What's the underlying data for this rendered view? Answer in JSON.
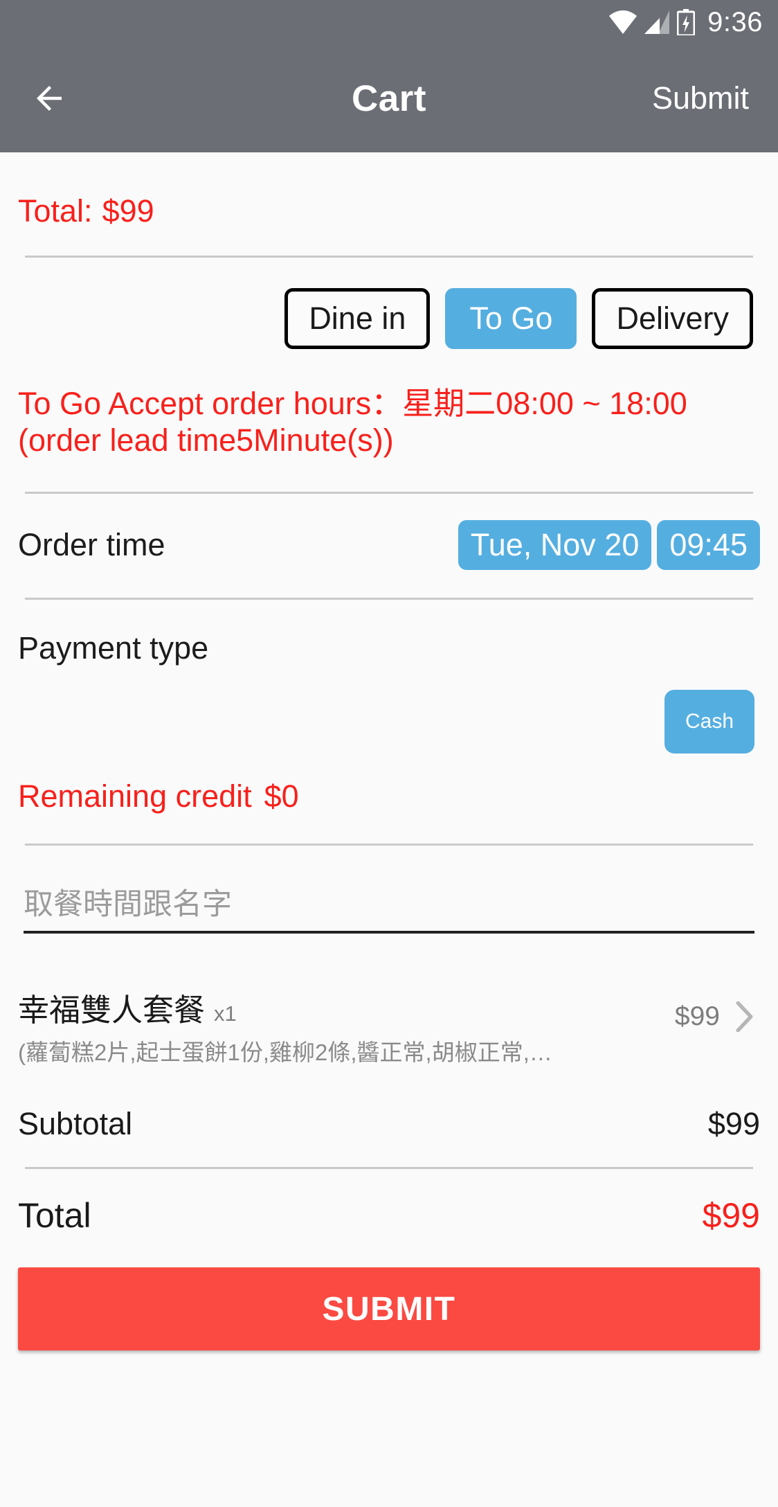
{
  "status_bar": {
    "clock": "9:36",
    "icons": [
      "wifi-icon",
      "cellular-signal-icon",
      "battery-charging-icon"
    ]
  },
  "app_bar": {
    "back_icon": "back-arrow-icon",
    "title": "Cart",
    "action_label": "Submit"
  },
  "summary_top": {
    "label": "Total:",
    "amount": "$99"
  },
  "order_type": {
    "options": [
      {
        "label": "Dine in",
        "selected": false
      },
      {
        "label": "To Go",
        "selected": true
      },
      {
        "label": "Delivery",
        "selected": false
      }
    ]
  },
  "notice": {
    "line1": "To Go Accept order hours：星期二08:00 ~ 18:00",
    "line2": "(order lead time5Minute(s))"
  },
  "order_time": {
    "label": "Order time",
    "date": "Tue, Nov 20",
    "time": "09:45"
  },
  "payment": {
    "label": "Payment type",
    "selected_method": "Cash"
  },
  "credit": {
    "label": "Remaining credit",
    "amount": "$0"
  },
  "note": {
    "value": "",
    "placeholder": "取餐時間跟名字"
  },
  "items": [
    {
      "name": "幸福雙人套餐",
      "qty": "x1",
      "description": "(蘿蔔糕2片,起士蛋餅1份,雞柳2條,醬正常,胡椒正常,…",
      "price": "$99",
      "chevron_icon": "chevron-right-icon"
    }
  ],
  "totals": {
    "subtotal_label": "Subtotal",
    "subtotal_value": "$99",
    "total_label": "Total",
    "total_value": "$99"
  },
  "submit": {
    "label": "SUBMIT"
  },
  "colors": {
    "appbar": "#6b6e74",
    "accent_blue": "#55aee0",
    "alert_red": "#f8201b",
    "submit_red": "#fa4a42",
    "page_bg": "#fafafa",
    "divider": "#c9c9c9"
  }
}
